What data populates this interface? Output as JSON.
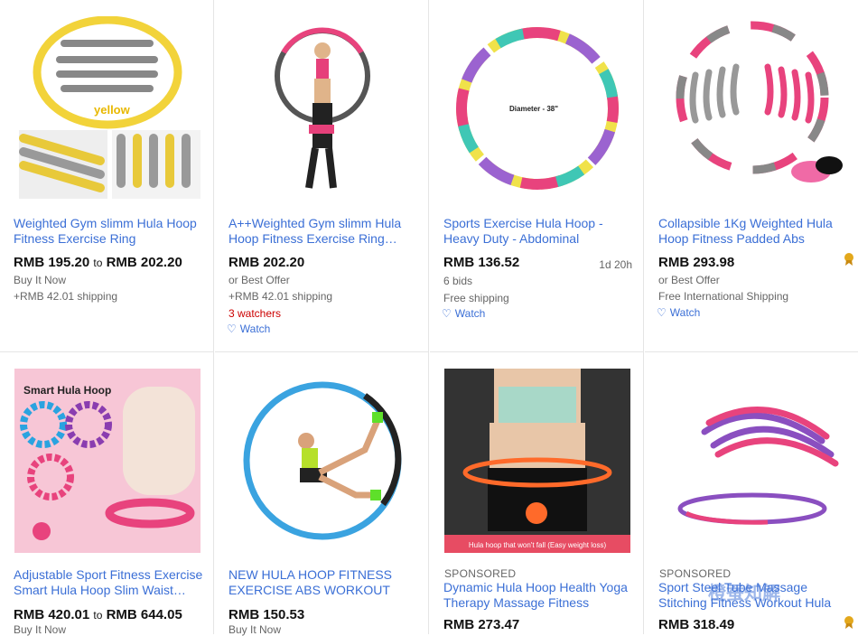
{
  "items": [
    {
      "title": "Weighted Gym slimm Hula Hoop Fitness Exercise Ring Adjustable…",
      "price_low": "RMB 195.20",
      "price_to": "to",
      "price_high": "RMB 202.20",
      "line1": "Buy It Now",
      "line2": "+RMB 42.01 shipping",
      "image_caption": "yellow"
    },
    {
      "title": "A++Weighted Gym slimm Hula Hoop Fitness Exercise Ring…",
      "price": "RMB 202.20",
      "line1": "or Best Offer",
      "line2": "+RMB 42.01 shipping",
      "watchers": "3 watchers",
      "watch": "Watch"
    },
    {
      "title": "Sports Exercise Hula Hoop - Heavy Duty - Abdominal Massag…",
      "price": "RMB 136.52",
      "time_left": "1d 20h",
      "line1": "6 bids",
      "line2": "Free shipping",
      "watch": "Watch",
      "image_caption": "Diameter - 38\""
    },
    {
      "title": "Collapsible 1Kg Weighted Hula Hoop Fitness Padded Abs Exerci…",
      "price": "RMB 293.98",
      "line1": "or Best Offer",
      "line2": "Free International Shipping",
      "watch": "Watch"
    },
    {
      "title": "Adjustable Sport Fitness Exercise Smart Hula Hoop Slim Waist…",
      "price_low": "RMB 420.01",
      "price_to": "to",
      "price_high": "RMB 644.05",
      "line1": "Buy It Now",
      "image_caption": "Smart Hula Hoop"
    },
    {
      "title": "NEW HULA HOOP FITNESS EXERCISE ABS WORKOUT GY…",
      "price": "RMB 150.53",
      "line1": "Buy It Now"
    },
    {
      "sponsored": "SPONSORED",
      "title": "Dynamic Hula Hoop Health Yoga Therapy Massage Fitness Waist…",
      "price": "RMB 273.47",
      "image_caption": "Hula hoop that won't fall (Easy weight loss)"
    },
    {
      "sponsored": "SPONSORED",
      "title": "Sport Steel Tube Massage Stitching Fitness Workout Hula Ho…",
      "price": "RMB 318.49",
      "watermark": "橙蚕知解"
    }
  ],
  "colors": {
    "link": "#3b6fd6",
    "watchers": "#cc0000",
    "price": "#111111"
  }
}
